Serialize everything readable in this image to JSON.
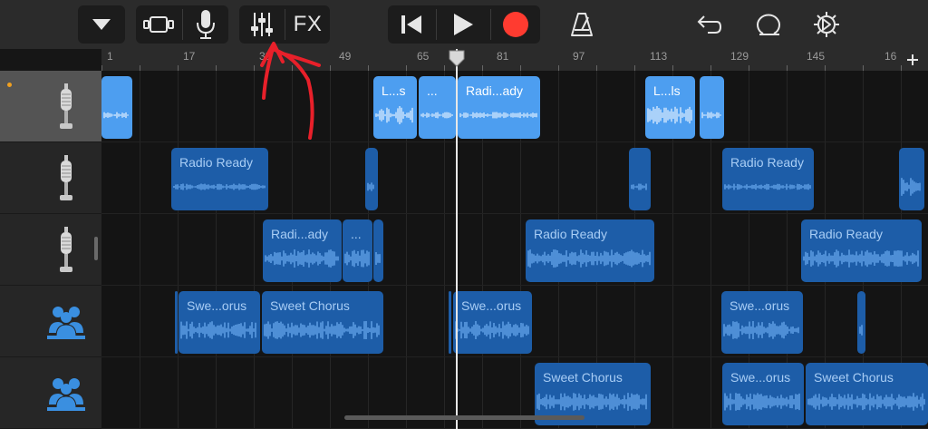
{
  "toolbar": {
    "fx_label": "FX",
    "colors": {
      "record": "#ff3b30",
      "icon": "#e6e6e6",
      "group_bg": "#1c1c1c"
    }
  },
  "ruler": {
    "bar_numbers": [
      "1",
      "17",
      "33",
      "49",
      "65",
      "81",
      "97",
      "113",
      "129",
      "145",
      "16"
    ],
    "add_track_icon": "plus-icon"
  },
  "tracks": [
    {
      "instrument_icon": "microphone-icon",
      "selected": true,
      "activity_dot": true
    },
    {
      "instrument_icon": "microphone-icon",
      "selected": false,
      "activity_dot": false
    },
    {
      "instrument_icon": "microphone-icon",
      "selected": false,
      "activity_dot": false
    },
    {
      "instrument_icon": "drummer-icon",
      "selected": false,
      "activity_dot": false
    },
    {
      "instrument_icon": "drummer-icon",
      "selected": false,
      "activity_dot": false
    }
  ],
  "regions": [
    {
      "track": 0,
      "label": "",
      "shade": "light"
    },
    {
      "track": 0,
      "label": "L...s",
      "shade": "light"
    },
    {
      "track": 0,
      "label": "...",
      "shade": "light"
    },
    {
      "track": 0,
      "label": "Radi...ady",
      "shade": "light"
    },
    {
      "track": 0,
      "label": "L...ls",
      "shade": "light"
    },
    {
      "track": 0,
      "label": "",
      "shade": "light"
    },
    {
      "track": 1,
      "label": "Radio Ready",
      "shade": "dark"
    },
    {
      "track": 1,
      "label": "",
      "shade": "dark"
    },
    {
      "track": 1,
      "label": "",
      "shade": "dark"
    },
    {
      "track": 1,
      "label": "Radio Ready",
      "shade": "dark"
    },
    {
      "track": 1,
      "label": "",
      "shade": "dark"
    },
    {
      "track": 2,
      "label": "Radi...ady",
      "shade": "dark"
    },
    {
      "track": 2,
      "label": "...",
      "shade": "dark"
    },
    {
      "track": 2,
      "label": "",
      "shade": "dark"
    },
    {
      "track": 2,
      "label": "Radio Ready",
      "shade": "dark"
    },
    {
      "track": 2,
      "label": "Radio Ready",
      "shade": "dark"
    },
    {
      "track": 3,
      "label": "",
      "shade": "dark"
    },
    {
      "track": 3,
      "label": "Swe...orus",
      "shade": "dark"
    },
    {
      "track": 3,
      "label": "Sweet Chorus",
      "shade": "dark"
    },
    {
      "track": 3,
      "label": "",
      "shade": "dark"
    },
    {
      "track": 3,
      "label": "Swe...orus",
      "shade": "dark"
    },
    {
      "track": 3,
      "label": "Swe...orus",
      "shade": "dark"
    },
    {
      "track": 3,
      "label": "",
      "shade": "dark"
    },
    {
      "track": 4,
      "label": "Sweet Chorus",
      "shade": "dark"
    },
    {
      "track": 4,
      "label": "Swe...orus",
      "shade": "dark"
    },
    {
      "track": 4,
      "label": "Sweet Chorus",
      "shade": "dark"
    }
  ],
  "annotation": {
    "color": "#e8202a"
  }
}
